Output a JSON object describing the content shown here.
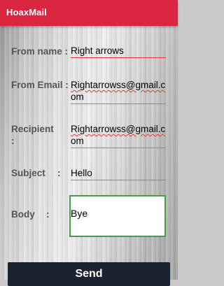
{
  "app_bar": {
    "title": "HoaxMail"
  },
  "form": {
    "from_name": {
      "label": "From name :",
      "value": "Right arrows"
    },
    "from_email": {
      "label": "From Email :",
      "value_line1": "Rightarrowss@gmail.c",
      "value_line2": "om"
    },
    "recipient": {
      "label_line1": "Recipient",
      "label_line2": ":",
      "value_line1": "Rightarrowss@gmail.c",
      "value_line2": "om"
    },
    "subject": {
      "label": "Subject",
      "label_colon": ":",
      "value": "Hello"
    },
    "body": {
      "label": "Body",
      "label_colon": ":",
      "value": "Bye"
    }
  },
  "actions": {
    "send_label": "Send"
  },
  "colors": {
    "app_bar": "#d9263f",
    "send_button": "#1b2330",
    "body_focus_border": "#43a047",
    "spellcheck_underline": "#e0393e"
  }
}
